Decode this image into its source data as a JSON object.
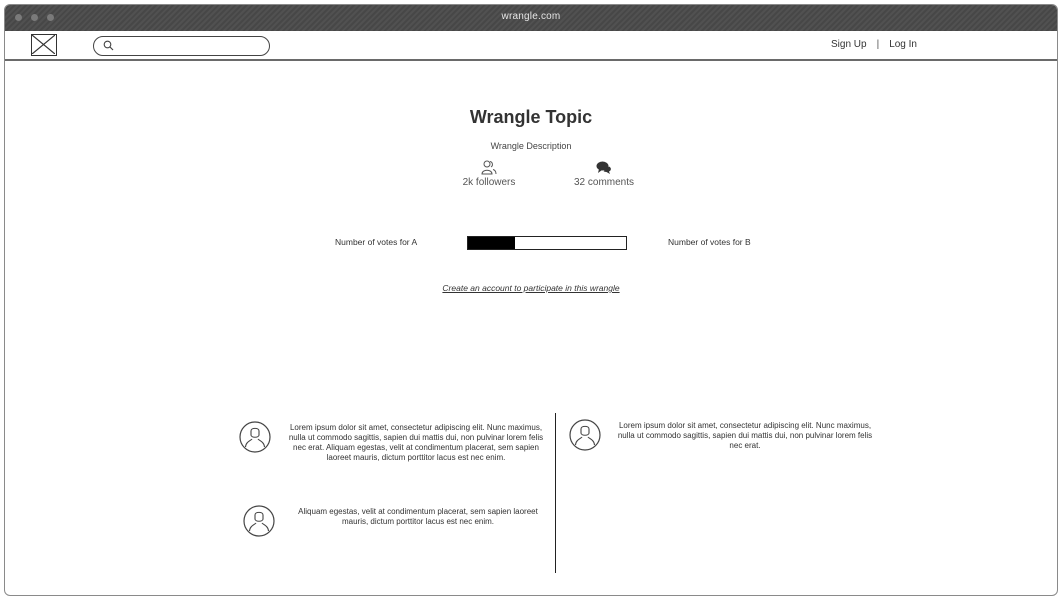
{
  "window": {
    "url": "wrangle.com"
  },
  "nav": {
    "logo_icon": "image-placeholder-icon",
    "search": {
      "value": "",
      "placeholder": ""
    },
    "links": {
      "signup": "Sign Up",
      "separator": "|",
      "login": "Log In"
    }
  },
  "topic": {
    "title": "Wrangle Topic",
    "description": "Wrangle Description",
    "followers": "2k followers",
    "followers_icon": "users-icon",
    "comments": "32 comments",
    "comments_icon": "comments-icon"
  },
  "vote": {
    "label_a": "Number of votes for A",
    "label_b": "Number of votes for B",
    "share_a": 0.3,
    "fill_color": "#000000"
  },
  "cta": "Create an account to participate in this wrangle",
  "comments": [
    {
      "icon": "user-avatar-icon",
      "text": "Lorem ipsum dolor sit amet, consectetur adipiscing elit. Nunc maximus, nulla ut commodo sagittis, sapien dui mattis dui, non pulvinar lorem felis nec erat. Aliquam egestas, velit at condimentum placerat, sem sapien laoreet mauris, dictum porttitor lacus est nec enim."
    },
    {
      "icon": "user-avatar-icon",
      "text": "Aliquam egestas, velit at condimentum placerat, sem sapien laoreet mauris, dictum porttitor lacus est nec enim."
    },
    {
      "icon": "user-avatar-icon",
      "text": "Lorem ipsum dolor sit amet, consectetur adipiscing elit. Nunc maximus, nulla ut commodo sagittis, sapien dui mattis dui, non pulvinar lorem felis nec erat."
    }
  ]
}
